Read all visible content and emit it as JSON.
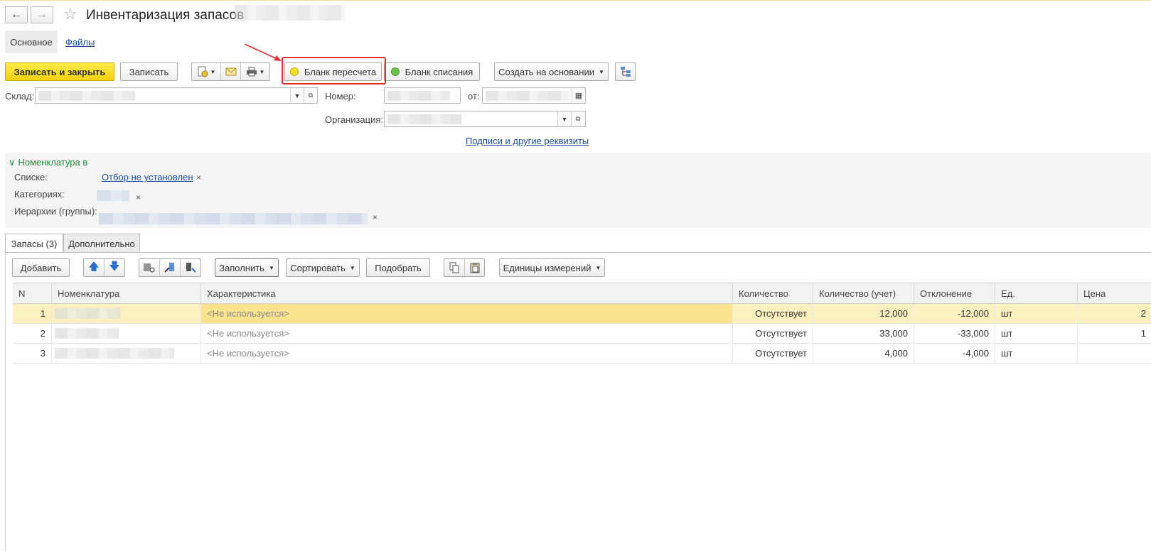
{
  "window": {
    "title": "Инвентаризация запасов"
  },
  "nav": {
    "tabs": [
      "Основное",
      "Файлы"
    ]
  },
  "toolbar": {
    "save_close": "Записать и закрыть",
    "save": "Записать",
    "recount_form": "Бланк пересчета",
    "writeoff_form": "Бланк списания",
    "create_based": "Создать на основании",
    "recount_color": "#f2e030",
    "writeoff_color": "#6cc04a"
  },
  "form": {
    "warehouse_label": "Склад:",
    "number_label": "Номер:",
    "from_label": "от:",
    "org_label": "Организация:",
    "signatures_link": "Подписи и другие реквизиты"
  },
  "filter": {
    "title": "Номенклатура в",
    "lists_label": "Списке:",
    "lists_value": "Отбор не установлен",
    "categories_label": "Категориях:",
    "hierarchy_label": "Иерархии (группы):"
  },
  "tabs": [
    "Запасы (3)",
    "Дополнительно"
  ],
  "table_toolbar": {
    "add": "Добавить",
    "fill": "Заполнить",
    "sort": "Сортировать",
    "pick": "Подобрать",
    "units": "Единицы измерений"
  },
  "table": {
    "columns": [
      "N",
      "Номенклатура",
      "Характеристика",
      "Количество",
      "Количество (учет)",
      "Отклонение",
      "Ед.",
      "Цена"
    ],
    "rows": [
      {
        "n": "1",
        "characteristic": "<Не используется>",
        "qty": "Отсутствует",
        "qty_acc": "12,000",
        "deviation": "-12,000",
        "unit": "шт",
        "price": "2"
      },
      {
        "n": "2",
        "characteristic": "<Не используется>",
        "qty": "Отсутствует",
        "qty_acc": "33,000",
        "deviation": "-33,000",
        "unit": "шт",
        "price": "1"
      },
      {
        "n": "3",
        "characteristic": "<Не используется>",
        "qty": "Отсутствует",
        "qty_acc": "4,000",
        "deviation": "-4,000",
        "unit": "шт",
        "price": ""
      }
    ]
  }
}
